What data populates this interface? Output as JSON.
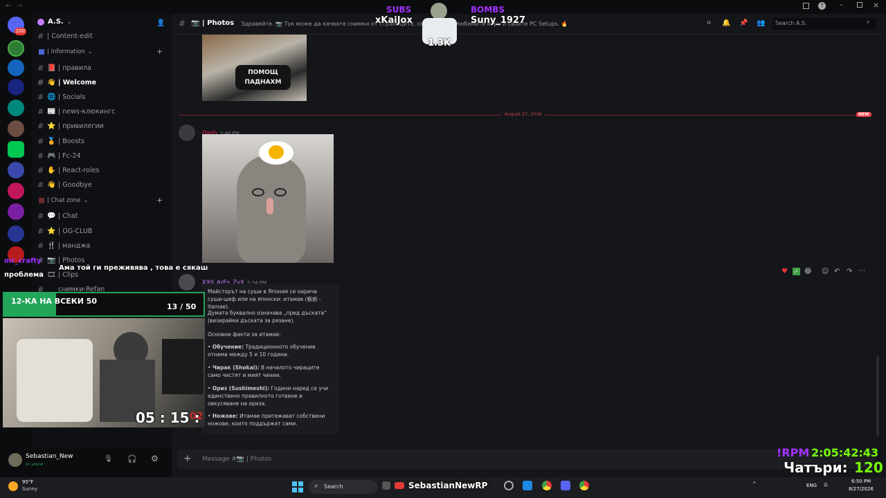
{
  "server": {
    "name": "A.S."
  },
  "rail_badge": "200",
  "channel": {
    "name": "| Photos",
    "topic": "Здравейте. 📷 Тук може да качвате снимки от страниците, снимки от ... любимите игри и своите PC Setups. 🔥"
  },
  "search": {
    "placeholder": "Search A.S."
  },
  "sidebar": {
    "top_item": "| Content-edit",
    "categories": [
      {
        "label": "| Information",
        "items": [
          {
            "emoji": "📕",
            "label": "| правила"
          },
          {
            "emoji": "👋",
            "label": "| Welcome",
            "active": true
          },
          {
            "emoji": "🌐",
            "label": "| Socials"
          },
          {
            "emoji": "📰",
            "label": "| news-клюкингс"
          },
          {
            "emoji": "⭐",
            "label": "| привилегии"
          },
          {
            "emoji": "🏅",
            "label": "| Boosts"
          },
          {
            "emoji": "🎮",
            "label": "| Fc-24"
          },
          {
            "emoji": "✋",
            "label": "| React-roles"
          },
          {
            "emoji": "👋",
            "label": "| Goodbye"
          }
        ]
      },
      {
        "label": "| Chat zone",
        "items": [
          {
            "emoji": "💬",
            "label": "| Chat"
          },
          {
            "emoji": "⭐",
            "label": "| OG-CLUB"
          },
          {
            "emoji": "🍴",
            "label": "| манджа"
          },
          {
            "emoji": "📷",
            "label": "| Photos"
          },
          {
            "emoji": "🎞",
            "label": "| Clips"
          },
          {
            "emoji": "",
            "label": "снимки-Refan"
          }
        ]
      }
    ]
  },
  "messages": {
    "date_divider": "August 27, 2026",
    "new_badge": "NEW",
    "msg1": {
      "author": "Dash",
      "time": "3:48 PM"
    },
    "msg2": {
      "author": "XXII_ArEs_ZvX",
      "time": "5:34 PM",
      "p1": "Майсторът на суши в Япония се нарича суши-шеф или на японски: итамае (板前 - itamae).",
      "p2": "Думата буквално означава „пред дъската“ (визирайки дъската за рязане).",
      "p3": "Основни факти за итамае:",
      "bullets": [
        {
          "b": "Обучение:",
          "t": " Традиционното обучение отнема между 5 и 10 години."
        },
        {
          "b": "Чирак (Shokai):",
          "t": " В началото чираците само чистят и мият чинии."
        },
        {
          "b": "Ориз (Sushimeshi):",
          "t": " Години наред се учи единствено правилното готвене и овкусяване на ориза."
        },
        {
          "b": "Ножове:",
          "t": " Итамае притежават собствени ножове, които поддържат сами."
        }
      ]
    }
  },
  "composer": {
    "placeholder": "Message #📷 | Photos"
  },
  "user": {
    "name": "Sebastian_New",
    "status": "In voice"
  },
  "stream": {
    "subs_label": "SUBS",
    "subs_user": "xKaiJox",
    "bombs_label": "BOMBS",
    "bombs_user": "Suny_1927",
    "count": "1.3K",
    "chat_user": "mr_crafty",
    "chat_text": "Ама той ги преживява , това е сякаш",
    "chat_text2": "проблема",
    "goal_label": "12-КА НА ВСЕКИ 50",
    "goal_value": "13 / 50",
    "goal_progress": 0.26,
    "timer": "05 : 15 :",
    "timer_red": "02",
    "rpm_label": "!RPM",
    "rpm_time": "2:05:42:43",
    "chatri_label": "Чатъри:",
    "chatri_value": "120",
    "taskbar_overlay": "SebastianNewRP"
  },
  "taskbar": {
    "weather_temp": "95°F",
    "weather_desc": "Sunny",
    "search": "Search",
    "lang": "ENG",
    "time": "6:50 PM",
    "date": "8/27/2026"
  },
  "colors": {
    "accent": "#23a55a",
    "brand": "#5865f2",
    "new": "#f23f43",
    "subs": "#a033ff"
  }
}
